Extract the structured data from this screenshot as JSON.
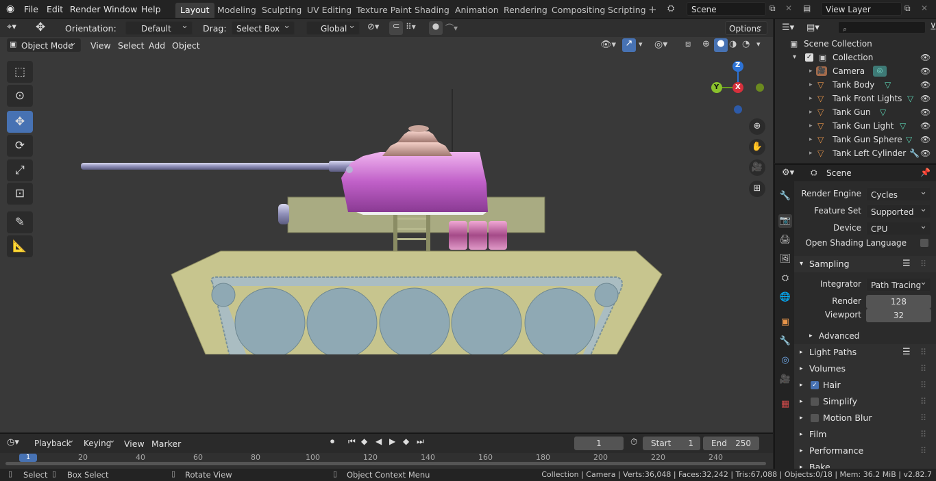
{
  "menu": [
    "File",
    "Edit",
    "Render",
    "Window",
    "Help"
  ],
  "workspaces": [
    "Layout",
    "Modeling",
    "Sculpting",
    "UV Editing",
    "Texture Paint",
    "Shading",
    "Animation",
    "Rendering",
    "Compositing",
    "Scripting"
  ],
  "active_workspace": "Layout",
  "scene_name": "Scene",
  "view_layer": "View Layer",
  "header": {
    "orientation_label": "Orientation:",
    "orientation_value": "Default",
    "drag_label": "Drag:",
    "drag_value": "Select Box",
    "transform_orientation": "Global",
    "options": "Options"
  },
  "viewport_header": {
    "mode": "Object Mode",
    "menus": [
      "View",
      "Select",
      "Add",
      "Object"
    ]
  },
  "gizmo": {
    "z": "Z",
    "y": "Y",
    "x": "X"
  },
  "timeline": {
    "menus": [
      "Playback",
      "Keying",
      "View",
      "Marker"
    ],
    "current_frame": "1",
    "start_label": "Start",
    "start_value": "1",
    "end_label": "End",
    "end_value": "250",
    "ruler": [
      "1",
      "20",
      "40",
      "60",
      "80",
      "100",
      "120",
      "140",
      "160",
      "180",
      "200",
      "220",
      "240"
    ]
  },
  "status": {
    "select": "Select",
    "box_select": "Box Select",
    "rotate_view": "Rotate View",
    "context_menu": "Object Context Menu",
    "stats": "Collection | Camera | Verts:36,048 | Faces:32,242 | Tris:67,088 | Objects:0/18 | Mem: 36.2 MiB | v2.82.7"
  },
  "outliner": {
    "root": "Scene Collection",
    "collection": "Collection",
    "items": [
      "Camera",
      "Tank Body",
      "Tank Front Lights",
      "Tank Gun",
      "Tank Gun Light",
      "Tank Gun Sphere",
      "Tank Left Cylinder"
    ]
  },
  "properties": {
    "context": "Scene",
    "render_engine_label": "Render Engine",
    "render_engine": "Cycles",
    "feature_set_label": "Feature Set",
    "feature_set": "Supported",
    "device_label": "Device",
    "device": "CPU",
    "osl_label": "Open Shading Language",
    "sampling": "Sampling",
    "integrator_label": "Integrator",
    "integrator": "Path Tracing",
    "render_label": "Render",
    "render_samples": "128",
    "viewport_label": "Viewport",
    "viewport_samples": "32",
    "advanced": "Advanced",
    "panels": [
      "Light Paths",
      "Volumes",
      "Hair",
      "Simplify",
      "Motion Blur",
      "Film",
      "Performance",
      "Bake"
    ]
  },
  "colors": {
    "accent": "#4772b3",
    "active_tab": "#3d3d3d",
    "tank_turret": "#c77bd0",
    "tank_body": "#c7c58e",
    "wheels": "#8fa9b4"
  }
}
